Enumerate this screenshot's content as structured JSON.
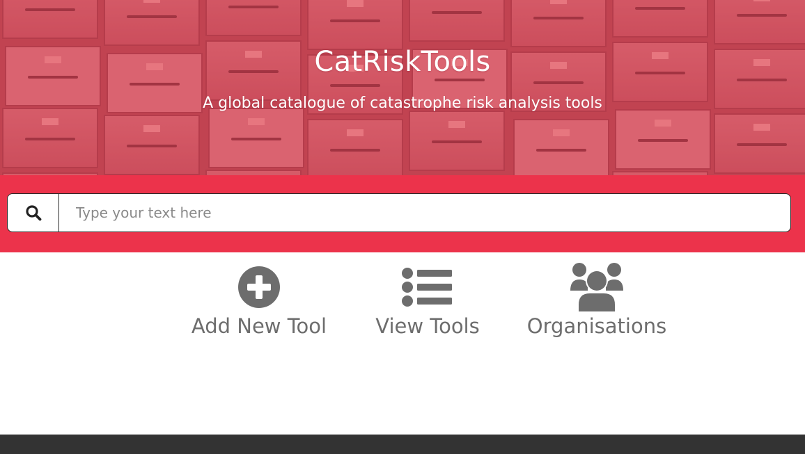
{
  "hero": {
    "title": "CatRiskTools",
    "subtitle": "A global catalogue of catastrophe risk analysis tools"
  },
  "search": {
    "placeholder": "Type your text here",
    "value": "",
    "icon": "search-icon"
  },
  "actions": [
    {
      "label": "Add New Tool",
      "icon": "plus-circle-icon"
    },
    {
      "label": "View Tools",
      "icon": "list-icon"
    },
    {
      "label": "Organisations",
      "icon": "users-icon"
    }
  ],
  "colors": {
    "hero_tint": "#c95561",
    "search_band": "#ec334b",
    "icon_gray": "#6d6d6d",
    "footer": "#333333"
  }
}
